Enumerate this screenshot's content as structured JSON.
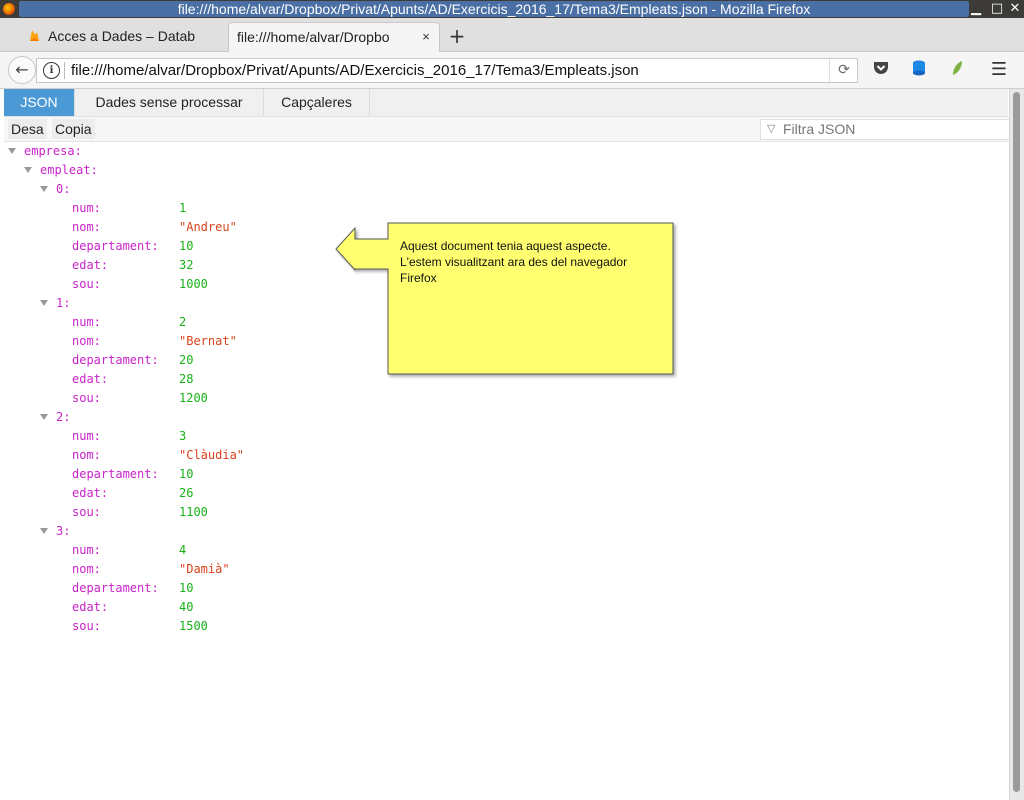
{
  "window": {
    "title": "file:///home/alvar/Dropbox/Privat/Apunts/AD/Exercicis_2016_17/Tema3/Empleats.json - Mozilla Firefox"
  },
  "tabs": [
    {
      "label": "Acces a Dades – Datab",
      "icon": "firebase-icon"
    },
    {
      "label": "file:///home/alvar/Dropbo",
      "close": "×"
    }
  ],
  "newtab_label": "+",
  "address_bar": {
    "url": "file:///home/alvar/Dropbox/Privat/Apunts/AD/Exercicis_2016_17/Tema3/Empleats.json"
  },
  "viewer": {
    "tabs": [
      "JSON",
      "Dades sense processar",
      "Capçaleres"
    ],
    "buttons": {
      "save": "Desa",
      "copy": "Copia"
    },
    "filter_placeholder": "Filtra JSON"
  },
  "tree": {
    "root_key": "empresa:",
    "list_key": "empleat:",
    "field_labels": {
      "num": "num:",
      "nom": "nom:",
      "departament": "departament:",
      "edat": "edat:",
      "sou": "sou:"
    },
    "employees": [
      {
        "index": "0:",
        "num": "1",
        "nom": "\"Andreu\"",
        "departament": "10",
        "edat": "32",
        "sou": "1000"
      },
      {
        "index": "1:",
        "num": "2",
        "nom": "\"Bernat\"",
        "departament": "20",
        "edat": "28",
        "sou": "1200"
      },
      {
        "index": "2:",
        "num": "3",
        "nom": "\"Clàudia\"",
        "departament": "10",
        "edat": "26",
        "sou": "1100"
      },
      {
        "index": "3:",
        "num": "4",
        "nom": "\"Damià\"",
        "departament": "10",
        "edat": "40",
        "sou": "1500"
      }
    ]
  },
  "callout": {
    "lines": [
      "Aquest document tenia aquest aspecte.",
      "L'estem visualitzant ara des del navegador",
      "Firefox"
    ],
    "color": "#ffff70"
  },
  "colors": {
    "key": "#c924c9",
    "number": "#18b318",
    "string": "#d9431b",
    "active_tab": "#4b9ad5"
  }
}
